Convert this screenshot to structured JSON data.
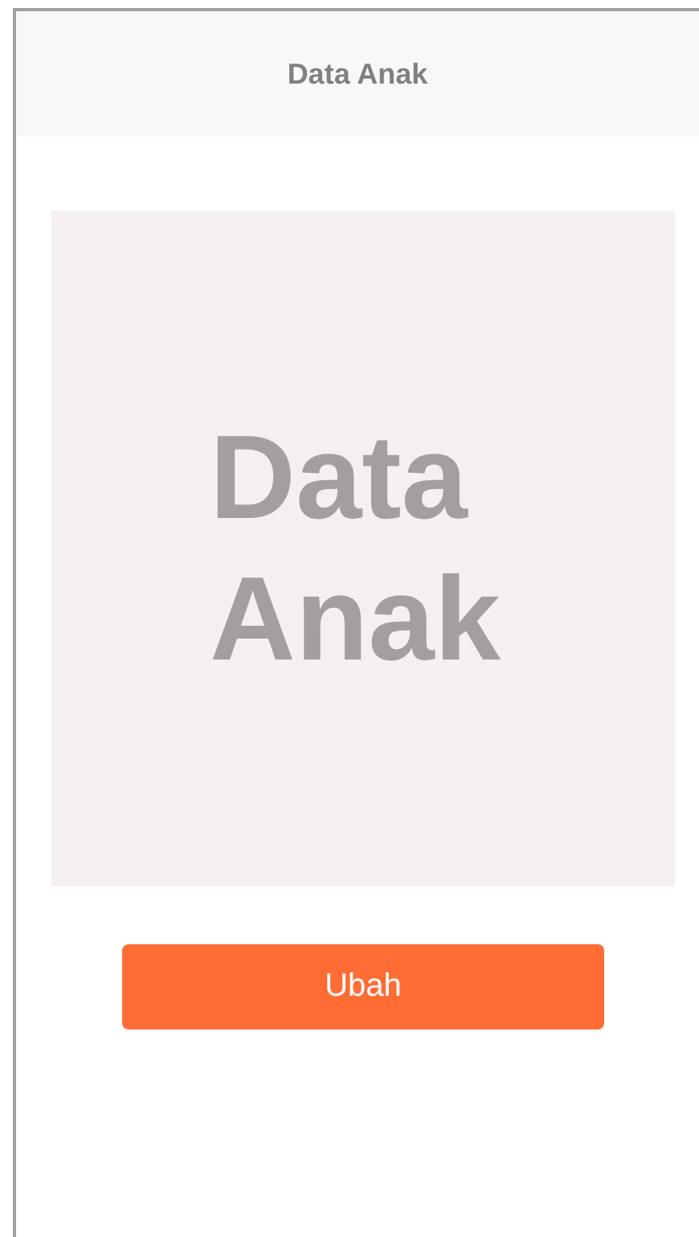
{
  "header": {
    "title": "Data Anak"
  },
  "image_placeholder": {
    "lines": [
      "Data",
      "Anak"
    ]
  },
  "button": {
    "label": "Ubah"
  }
}
